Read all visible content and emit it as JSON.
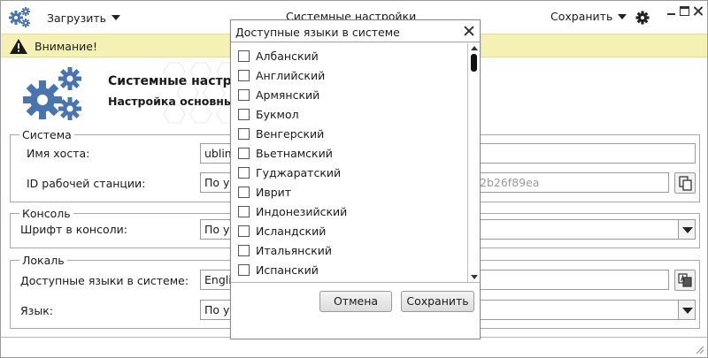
{
  "header": {
    "load_label": "Загрузить",
    "window_title": "Системные настройки",
    "save_label": "Сохранить"
  },
  "alert": {
    "text": "Внимание!"
  },
  "banner": {
    "title": "Системные настрой",
    "subtitle": "Настройка основных п"
  },
  "system": {
    "legend": "Система",
    "hostname_label": "Имя хоста:",
    "hostname_value": "ublin",
    "station_id_label": "ID рабочей станции:",
    "station_id_value": "По ум",
    "station_id_ghost": "2b26f89ea"
  },
  "console": {
    "legend": "Консоль",
    "font_label": "Шрифт в консоли:",
    "font_value": "По ум"
  },
  "locale": {
    "legend": "Локаль",
    "langs_label": "Доступные языки в системе:",
    "langs_value": "Engli",
    "lang_label": "Язык:",
    "lang_value": "По ум"
  },
  "dialog": {
    "title": "Доступные языки в системе",
    "languages": [
      "Албанский",
      "Английский",
      "Армянский",
      "Букмол",
      "Венгерский",
      "Вьетнамский",
      "Гуджаратский",
      "Иврит",
      "Индонезийский",
      "Исландский",
      "Итальянский",
      "Испанский"
    ],
    "cancel_label": "Отмена",
    "save_label": "Сохранить"
  },
  "colors": {
    "alert_bg": "#f5f0b4",
    "gear_blue": "#4a74b0"
  }
}
